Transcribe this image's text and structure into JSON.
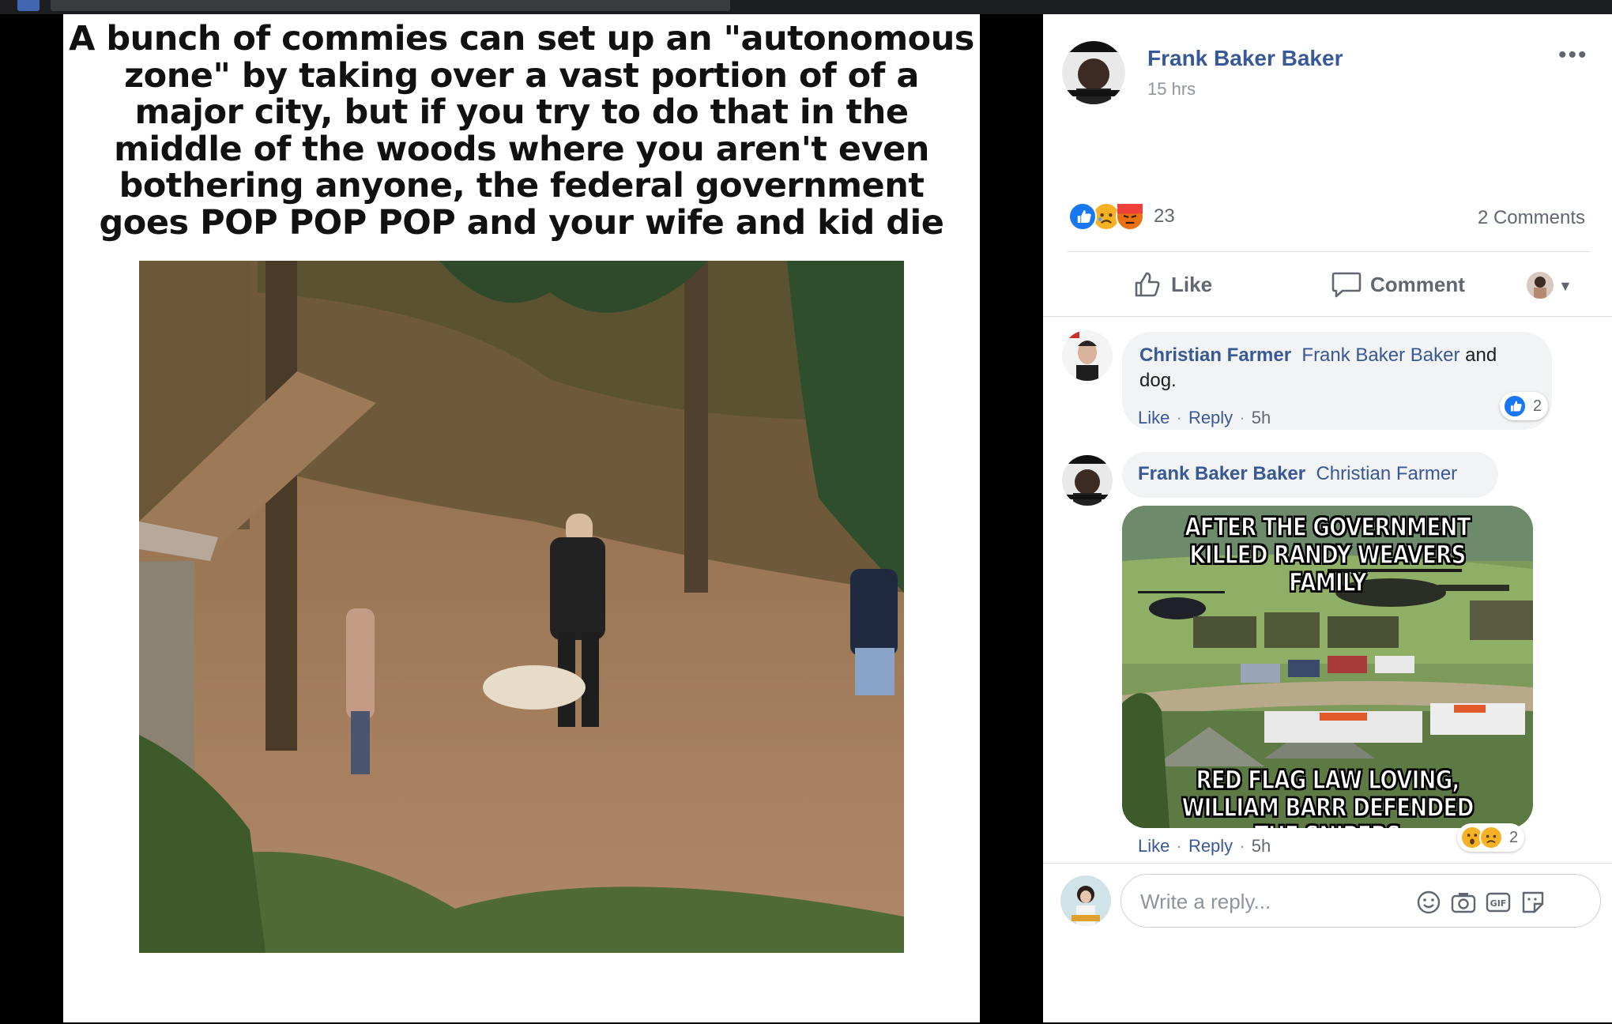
{
  "meme": {
    "caption_lines": [
      "A bunch of commies can set up an \"autonomous",
      "zone\" by taking over a vast portion of of a",
      "major city, but if you try to do that in the",
      "middle of the woods where you aren't even",
      "bothering anyone, the federal government",
      "goes POP POP POP and your wife and kid die"
    ]
  },
  "post": {
    "author": "Frank Baker Baker",
    "time": "15 hrs",
    "more": "•••",
    "reaction_count": "23",
    "comment_count": "2 Comments",
    "like_label": "Like",
    "comment_label": "Comment"
  },
  "comments": [
    {
      "author": "Christian Farmer",
      "mention": "Frank Baker Baker",
      "text_after": " and dog.",
      "like": "Like",
      "reply": "Reply",
      "time": "5h",
      "reaction_count": "2"
    },
    {
      "author": "Frank Baker Baker",
      "mention": "Christian Farmer",
      "image_top_text": "AFTER THE GOVERNMENT KILLED RANDY WEAVERS FAMILY",
      "image_bottom_text": "RED FLAG LAW LOVING, WILLIAM BARR DEFENDED THE SNIPERS",
      "like": "Like",
      "reply": "Reply",
      "time": "5h",
      "reaction_count": "2"
    }
  ],
  "reply_box": {
    "placeholder": "Write a reply..."
  },
  "colors": {
    "link": "#385898",
    "like_blue": "#1877f2",
    "angry": "#f25268",
    "sad": "#f7b125"
  }
}
